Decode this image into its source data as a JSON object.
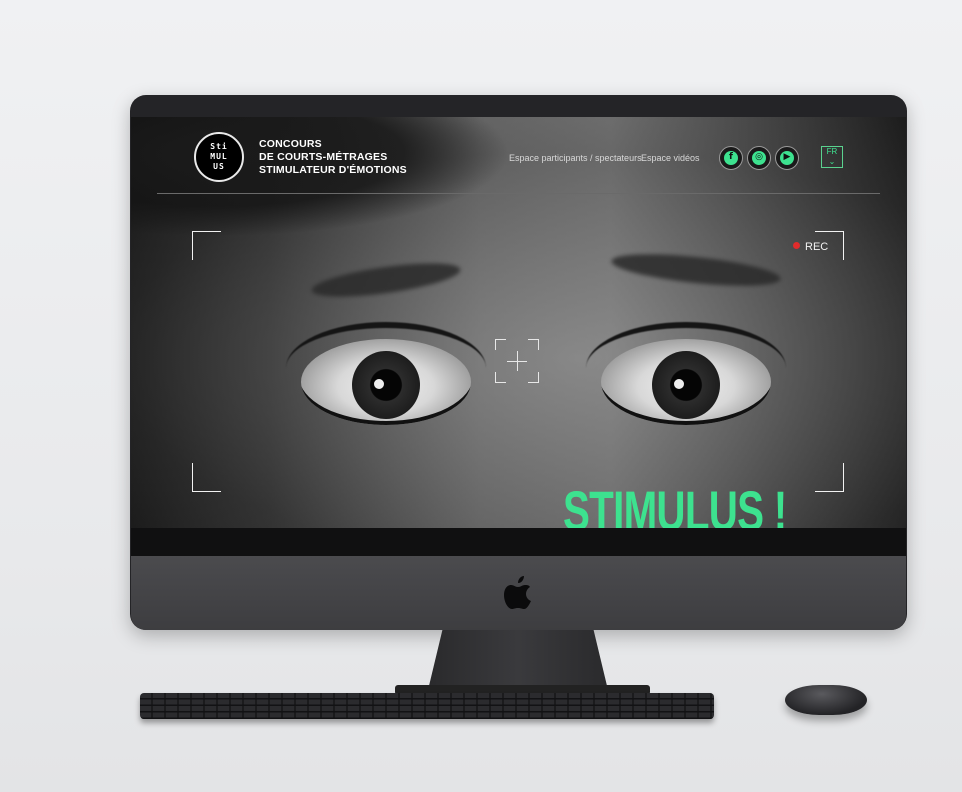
{
  "logo": {
    "lines": [
      "Sti",
      "MUL",
      "US"
    ]
  },
  "brand": {
    "line1": "CONCOURS",
    "line2": "DE COURTS-MÉTRAGES",
    "line3": "STIMULATEUR D'ÉMOTIONS"
  },
  "nav": {
    "participants": "Espace participants / spectateurs",
    "videos": "Espace vidéos"
  },
  "social": [
    {
      "icon": "facebook-icon",
      "glyph": "f"
    },
    {
      "icon": "instagram-icon",
      "glyph": "◎"
    },
    {
      "icon": "youtube-icon",
      "glyph": "▶"
    }
  ],
  "language": {
    "current": "FR",
    "chevron": "⌄"
  },
  "viewfinder": {
    "rec_label": "REC"
  },
  "hero": {
    "title": "STIMULUS !"
  },
  "colors": {
    "accent": "#3de28f",
    "rec": "#e02b2b",
    "screen_bg": "#0d0d0e"
  }
}
